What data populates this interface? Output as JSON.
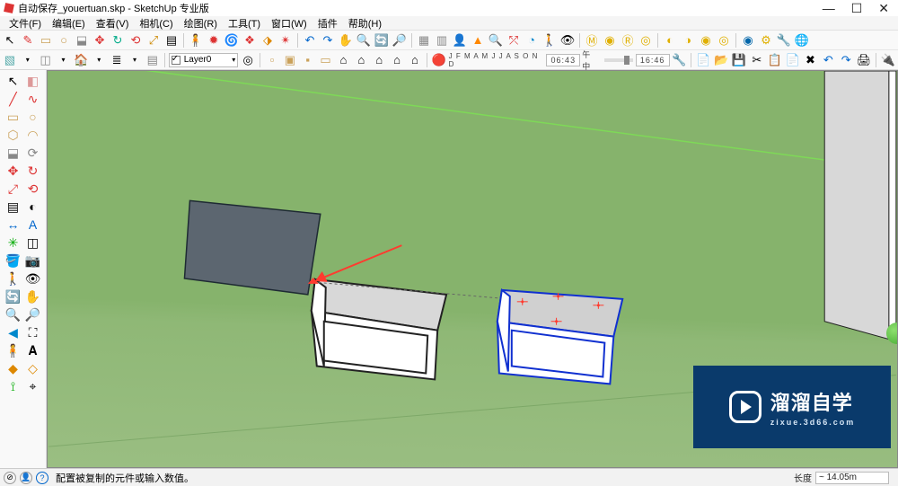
{
  "window": {
    "title": "自动保存_youertuan.skp - SketchUp 专业版"
  },
  "win_controls": {
    "min": "—",
    "max": "☐",
    "close": "✕"
  },
  "menu": {
    "file": "文件(F)",
    "edit": "编辑(E)",
    "view": "查看(V)",
    "camera": "相机(C)",
    "draw": "绘图(R)",
    "tools": "工具(T)",
    "window": "窗口(W)",
    "plugins": "插件",
    "help": "帮助(H)"
  },
  "layer": {
    "name": "Layer0"
  },
  "date_strip": {
    "months": "J F M A M J J A S O N D",
    "date": "06:43",
    "ampm": "午中",
    "time": "16:46"
  },
  "status": {
    "hint": "配置被复制的元件或输入数值。",
    "dim_label": "长度",
    "dim_value": "~ 14.05m"
  },
  "watermark": {
    "brand": "溜溜自学",
    "url": "zixue.3d66.com"
  },
  "icons": {
    "select": "↖",
    "eraser": "◧",
    "rect": "▭",
    "line": "╱",
    "arc": "◠",
    "circle": "○",
    "pushpull": "⬓",
    "move": "✥",
    "rotate": "↻",
    "scale": "⤢",
    "tape": "▤",
    "paint": "🪣",
    "orbit": "🔄",
    "pan": "✋",
    "zoom": "🔍",
    "zoomext": "🔎",
    "undo": "↶",
    "redo": "↷",
    "cut": "✂",
    "save": "💾",
    "open": "📂",
    "print": "🖨",
    "x": "✖",
    "plug": "🔌",
    "globe": "🌐",
    "target": "◎",
    "pencil": "✎",
    "bucket": "🪣",
    "text": "A",
    "dim": "↔",
    "protractor": "◐",
    "axes": "✳",
    "section": "◫",
    "walk": "🚶",
    "look": "👁",
    "person": "🧍",
    "cone": "▲",
    "yellow_ball": "●",
    "red_star": "✶",
    "blue_star": "✷",
    "red_flare": "✹",
    "swirl": "🌀",
    "house_row": "🏠",
    "layers": "≣",
    "folder": "📁",
    "doc": "📄",
    "wrench": "🔧",
    "gear": "⚙"
  }
}
